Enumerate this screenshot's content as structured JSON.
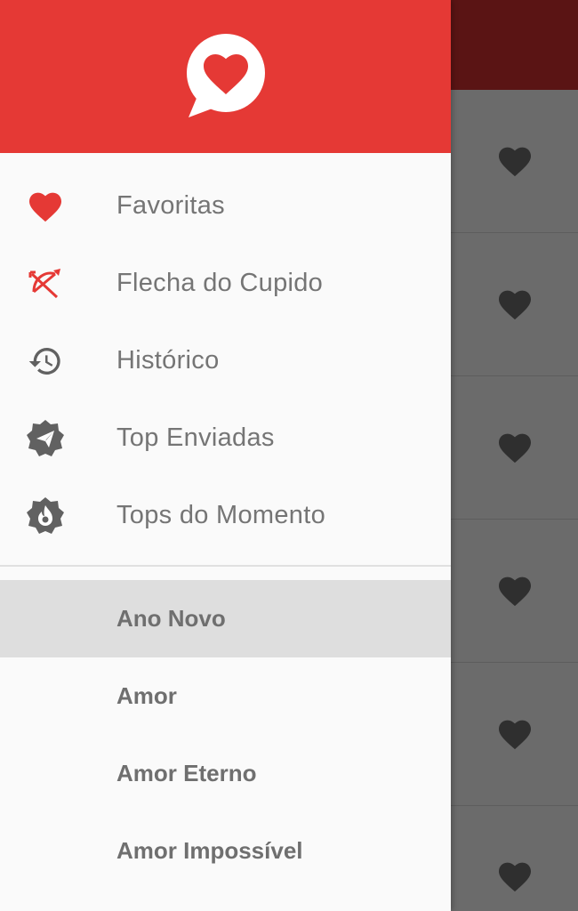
{
  "colors": {
    "header": "#e53935",
    "accent": "#e53935",
    "icon_gray": "#616161",
    "text_gray": "#757575",
    "selected_bg": "#dedede"
  },
  "header": {
    "logo_icon": "speech-bubble-heart-icon"
  },
  "menu": [
    {
      "label": "Favoritas",
      "icon": "heart-icon"
    },
    {
      "label": "Flecha do Cupido",
      "icon": "cupid-arrow-icon"
    },
    {
      "label": "Histórico",
      "icon": "history-icon"
    },
    {
      "label": "Top Enviadas",
      "icon": "send-badge-icon"
    },
    {
      "label": "Tops do Momento",
      "icon": "flame-badge-icon"
    }
  ],
  "categories": [
    {
      "label": "Ano Novo",
      "selected": true
    },
    {
      "label": "Amor",
      "selected": false
    },
    {
      "label": "Amor Eterno",
      "selected": false
    },
    {
      "label": "Amor Impossível",
      "selected": false
    }
  ],
  "background_list": {
    "row_icon": "heart-icon"
  }
}
